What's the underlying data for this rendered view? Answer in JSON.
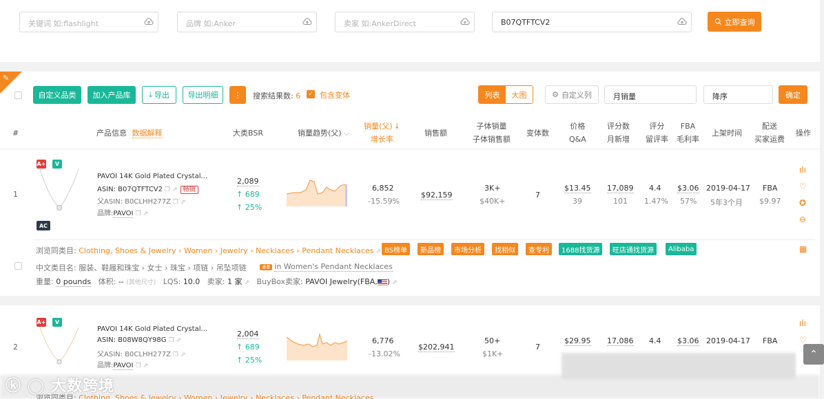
{
  "search": {
    "keyword_placeholder": "关键词 如:flashlight",
    "brand_placeholder": "品牌 如:Anker",
    "seller_placeholder": "卖家 如:AnkerDirect",
    "asin_value": "B07QTFTCV2",
    "query_label": "立即查询"
  },
  "toolbar": {
    "custom_category": "自定义品类",
    "add_library": "加入产品库",
    "export": "导出",
    "export_detail": "导出明细",
    "more": "⋮",
    "result_label": "搜索结果数:",
    "result_count": "6",
    "include_variants": "包含变体",
    "view_list": "列表",
    "view_grid": "大图",
    "custom_columns": "自定义列",
    "sort_field": "月销量",
    "sort_order": "降序",
    "confirm": "确定"
  },
  "header": {
    "index": "#",
    "product_info": "产品信息",
    "data_explain": "数据解释",
    "bsr": "大类BSR",
    "trend": "销量趋势(父)",
    "sales": "销量(父)",
    "growth": "增长率",
    "revenue": "销售额",
    "child_sales": "子体销量",
    "child_revenue": "子体销售额",
    "variants": "变体数",
    "price": "价格",
    "qa": "Q&A",
    "reviews": "评分数",
    "monthly_new": "月新增",
    "rating": "评分",
    "retention": "留评率",
    "fba": "FBA",
    "margin": "毛利率",
    "listed": "上架时间",
    "delivery": "配送",
    "buyer_ship": "买家运费",
    "ops": "操作"
  },
  "rows": [
    {
      "index": "1",
      "badge_a": "A+",
      "badge_v": "V",
      "badge_ac": "AC",
      "title": "PAVOI 14K Gold Plated Crystal...",
      "asin": "ASIN: B07QTFTCV2",
      "hot": "畅销",
      "parent_asin": "父ASIN: B0CLHH277Z",
      "brand_label": "品牌:",
      "brand": "PAVOI",
      "bsr": "2,089",
      "bsr_up": "↑ 689",
      "bsr_pct": "↑ 25%",
      "sales": "6,852",
      "growth": "-15.59%",
      "revenue": "$92,159",
      "child_sales": "3K+",
      "child_revenue": "$40K+",
      "variants": "7",
      "price": "$13.45",
      "qa": "39",
      "reviews": "17,089",
      "monthly_new": "101",
      "rating": "4.4",
      "retention": "1.47%",
      "fba": "$3.06",
      "margin": "57%",
      "listed": "2019-04-17",
      "age": "5年3个月",
      "delivery": "FBA",
      "ship_fee": "$9.97",
      "cat_label": "浏览同类目:",
      "cat_path": "Clothing, Shoes & Jewelry › Women › Jewelry › Necklaces › Pendant Necklaces",
      "cn_cat": "中文类目名: 服装、鞋履和珠宝 › 女士 › 珠宝 › 项链 › 吊坠项链",
      "rank": "#8",
      "rank_cat": "in Women's Pendant Necklaces",
      "weight_label": "重量:",
      "weight": "0 pounds",
      "size_label": "体积:",
      "size": "--",
      "size_note": "(其他尺寸)",
      "lqs_label": "LQS:",
      "lqs": "10.0",
      "sellers_label": "卖家:",
      "sellers": "1 家",
      "buybox_label": "BuyBox卖家:",
      "buybox": "PAVOI Jewelry(FBA,"
    },
    {
      "index": "2",
      "badge_a": "A+",
      "badge_v": "V",
      "title": "PAVOI 14K Gold Plated Crystal...",
      "asin": "ASIN: B08W8QY98G",
      "parent_asin": "父ASIN: B0CLHH277Z",
      "brand_label": "品牌:",
      "brand": "PAVOI",
      "bsr": "2,004",
      "bsr_up": "↑ 689",
      "bsr_pct": "↑ 25%",
      "sales": "6,776",
      "growth": "-13.02%",
      "revenue": "$202,941",
      "child_sales": "50+",
      "child_revenue": "$1K+",
      "variants": "7",
      "price": "$29.95",
      "reviews": "17,086",
      "rating": "4.4",
      "fba": "$3.06",
      "listed": "2019-04-17",
      "delivery": "FBA",
      "cat_label": "浏览同类目:",
      "cat_path": "Clothing, Shoes & Jewelry › Women › Jewelry › Necklaces › Pendant Necklaces"
    }
  ],
  "tags": [
    "BS榜单",
    "新品榜",
    "市场分析",
    "找相似",
    "查专利",
    "1688找货源",
    "旺店通找货源",
    "Alibaba"
  ],
  "watermark": "大数跨境",
  "colors": {
    "accent": "#f5871f",
    "teal": "#19b899",
    "red": "#e13c3c"
  }
}
